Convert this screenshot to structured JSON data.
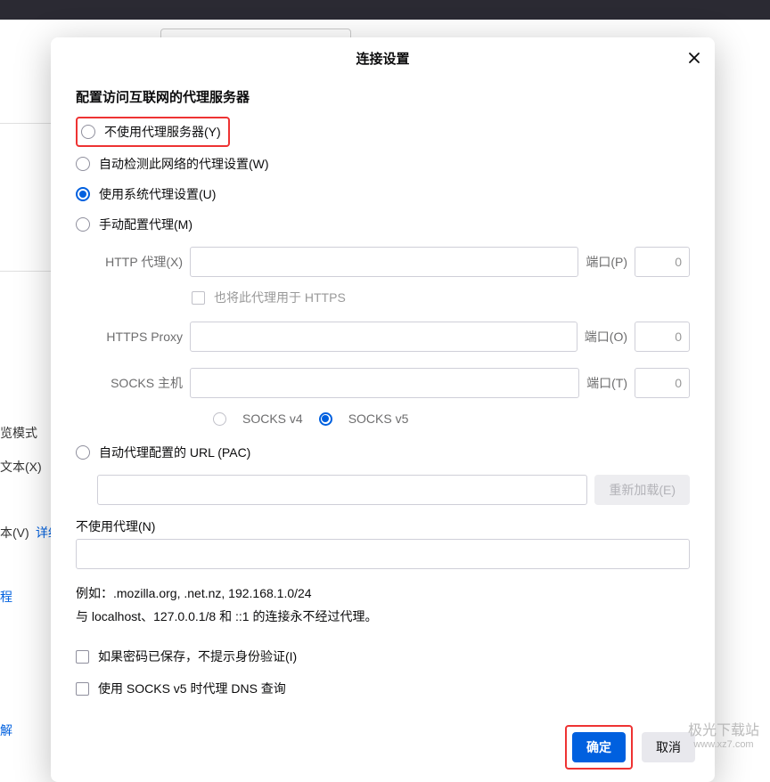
{
  "dialog": {
    "title": "连接设置",
    "section_title": "配置访问互联网的代理服务器",
    "radios": {
      "none": "不使用代理服务器(Y)",
      "auto_detect": "自动检测此网络的代理设置(W)",
      "system": "使用系统代理设置(U)",
      "manual": "手动配置代理(M)",
      "pac": "自动代理配置的 URL  (PAC)"
    },
    "http": {
      "label": "HTTP 代理(X)",
      "host": "",
      "port_label": "端口(P)",
      "port": "0"
    },
    "also_https": "也将此代理用于 HTTPS",
    "https": {
      "label": "HTTPS Proxy",
      "host": "",
      "port_label": "端口(O)",
      "port": "0"
    },
    "socks": {
      "label": "SOCKS 主机",
      "host": "",
      "port_label": "端口(T)",
      "port": "0",
      "v4": "SOCKS v4",
      "v5": "SOCKS v5"
    },
    "pac_url": "",
    "reload_btn": "重新加载(E)",
    "no_proxy_label": "不使用代理(N)",
    "no_proxy_value": "",
    "example": "例如：.mozilla.org, .net.nz, 192.168.1.0/24",
    "localhost_note": "与 localhost、127.0.0.1/8 和 ::1 的连接永不经过代理。",
    "cb_no_prompt": "如果密码已保存，不提示身份验证(I)",
    "cb_socks_dns": "使用 SOCKS v5 时代理 DNS 查询",
    "ok": "确定",
    "cancel": "取消"
  },
  "bg": {
    "browse_mode": "览模式",
    "find_text": "文本(X)",
    "font_v": "本(V)",
    "detail": "详细",
    "cheng": "程",
    "jie": "解"
  },
  "watermark": {
    "line1": "极光下载站",
    "line2": "www.xz7.com"
  }
}
